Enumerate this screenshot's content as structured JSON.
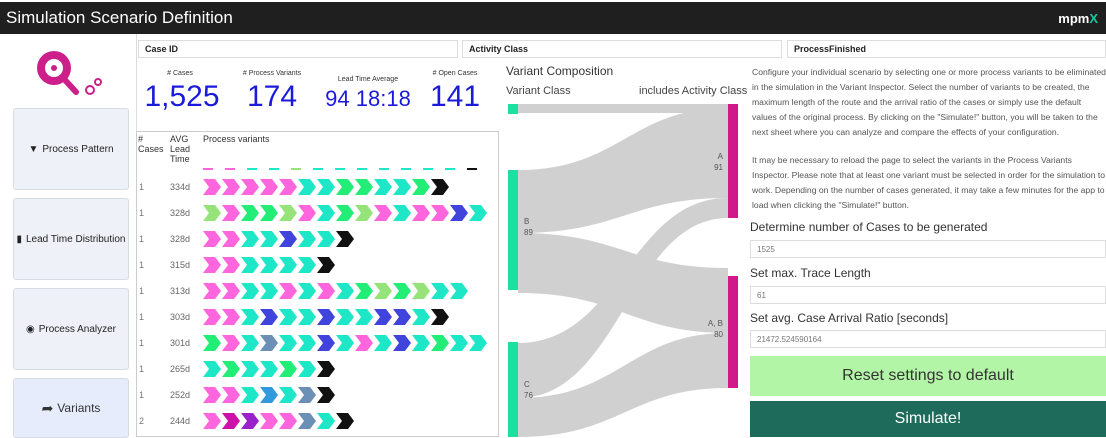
{
  "app": {
    "title": "Simulation Scenario Definition",
    "brand": "mpm",
    "brand_accent": "X"
  },
  "sidebar": {
    "items": [
      {
        "label": "Process Pattern",
        "icon": "filter-icon",
        "glyph": "▼"
      },
      {
        "label": "Lead Time Distribution",
        "icon": "bar-chart-icon",
        "glyph": "▮"
      },
      {
        "label": "Process Analyzer",
        "icon": "eye-icon",
        "glyph": "◉"
      },
      {
        "label": "Variants",
        "icon": "share-arrow-icon",
        "glyph": "➦"
      }
    ]
  },
  "filters": {
    "case_id": "Case ID",
    "activity_class": "Activity Class",
    "process_finished": "ProcessFinished"
  },
  "kpis": [
    {
      "label": "# Cases",
      "value": "1,525"
    },
    {
      "label": "# Process Variants",
      "value": "174"
    },
    {
      "label": "Lead Time Average",
      "value": "94 18:18"
    },
    {
      "label": "# Open Cases",
      "value": "141"
    }
  ],
  "variants_table": {
    "headers": {
      "cases": "# Cases",
      "lead_time": "AVG Lead Time",
      "variants": "Process variants"
    },
    "sort_icon": "▼",
    "rows": [
      {
        "cases": "1",
        "lead_time": "334d",
        "steps": [
          "#ff66dd",
          "#ff66dd",
          "#ff66dd",
          "#ff66dd",
          "#ff66dd",
          "#1ee7c8",
          "#1ee7c8",
          "#22ee77",
          "#22ee77",
          "#1ee7c8",
          "#1ee7c8",
          "#22ee77",
          "#111111"
        ]
      },
      {
        "cases": "1",
        "lead_time": "328d",
        "steps": [
          "#96e37a",
          "#ff66dd",
          "#22ee77",
          "#22ee77",
          "#96e37a",
          "#ff66dd",
          "#1ee7c8",
          "#22ee77",
          "#96e37a",
          "#ff66dd",
          "#1ee7c8",
          "#ff66dd",
          "#ff66dd",
          "#4044dd",
          "#1ee7c8"
        ]
      },
      {
        "cases": "1",
        "lead_time": "328d",
        "steps": [
          "#ff66dd",
          "#ff66dd",
          "#1ee7c8",
          "#1ee7c8",
          "#4044dd",
          "#1ee7c8",
          "#1ee7c8",
          "#111111"
        ]
      },
      {
        "cases": "1",
        "lead_time": "315d",
        "steps": [
          "#ff66dd",
          "#ff66dd",
          "#1ee7c8",
          "#1ee7c8",
          "#1ee7c8",
          "#1ee7c8",
          "#111111"
        ]
      },
      {
        "cases": "1",
        "lead_time": "313d",
        "steps": [
          "#ff66dd",
          "#ff66dd",
          "#1ee7c8",
          "#1ee7c8",
          "#ff66dd",
          "#1ee7c8",
          "#ff66dd",
          "#1ee7c8",
          "#22ee77",
          "#96e37a",
          "#22ee77",
          "#96e37a",
          "#1ee7c8",
          "#1ee7c8"
        ]
      },
      {
        "cases": "1",
        "lead_time": "303d",
        "steps": [
          "#ff66dd",
          "#ff66dd",
          "#1ee7c8",
          "#4044dd",
          "#1ee7c8",
          "#1ee7c8",
          "#4044dd",
          "#1ee7c8",
          "#1ee7c8",
          "#4044dd",
          "#4044dd",
          "#1ee7c8",
          "#111111"
        ]
      },
      {
        "cases": "1",
        "lead_time": "301d",
        "steps": [
          "#22ee77",
          "#ff66dd",
          "#1ee7c8",
          "#6b8fb5",
          "#1ee7c8",
          "#1ee7c8",
          "#4044dd",
          "#1ee7c8",
          "#ff66dd",
          "#1ee7c8",
          "#4044dd",
          "#1ee7c8",
          "#22ee77",
          "#1ee7c8",
          "#1ee7c8"
        ]
      },
      {
        "cases": "1",
        "lead_time": "265d",
        "steps": [
          "#1ee7c8",
          "#22ee77",
          "#1ee7c8",
          "#1ee7c8",
          "#22ee77",
          "#1ee7c8",
          "#111111"
        ]
      },
      {
        "cases": "1",
        "lead_time": "252d",
        "steps": [
          "#ff66dd",
          "#ff66dd",
          "#1ee7c8",
          "#3399dd",
          "#1ee7c8",
          "#6b8fb5",
          "#111111"
        ]
      },
      {
        "cases": "2",
        "lead_time": "244d",
        "steps": [
          "#ff66dd",
          "#cc11aa",
          "#9922cc",
          "#ff66dd",
          "#ff66dd",
          "#6b8fb5",
          "#1ee7c8",
          "#111111"
        ]
      }
    ]
  },
  "variant_composition": {
    "title": "Variant Composition",
    "left_header": "Variant Class",
    "right_header": "includes Activity Class",
    "left_nodes": [
      {
        "label": "",
        "value": ""
      },
      {
        "label": "B",
        "value": "89"
      },
      {
        "label": "C",
        "value": "76"
      }
    ],
    "right_nodes": [
      {
        "label": "A",
        "value": "91"
      },
      {
        "label": "A, B",
        "value": "80"
      }
    ]
  },
  "scenario": {
    "description_1": "Configure your individual scenario by selecting one or more process variants to be eliminated in the simulation in the Variant Inspector. Select the number of variants to be created, the maximum length of the route and the arrival ratio of the cases or simply use the default values of the original process. By clicking on the \"Simulate!\" button, you will be taken to the next sheet where you can analyze and compare the effects of your configuration.",
    "description_2": "It may be necessary to reload the page to select the variants in the Process Variants Inspector. Please note that at least one variant must be selected in order for the simulation to work. Depending on the number of cases generated, it may take a few minutes for the app to load when clicking the \"Simulate!\" button.",
    "cases_label": "Determine number of Cases to be generated",
    "cases_value": "1525",
    "trace_label": "Set max. Trace Length",
    "trace_value": "61",
    "arrival_label": "Set avg. Case Arrival Ratio [seconds]",
    "arrival_value": "21472.524590164",
    "reset_label": "Reset settings to default",
    "simulate_label": "Simulate!"
  }
}
